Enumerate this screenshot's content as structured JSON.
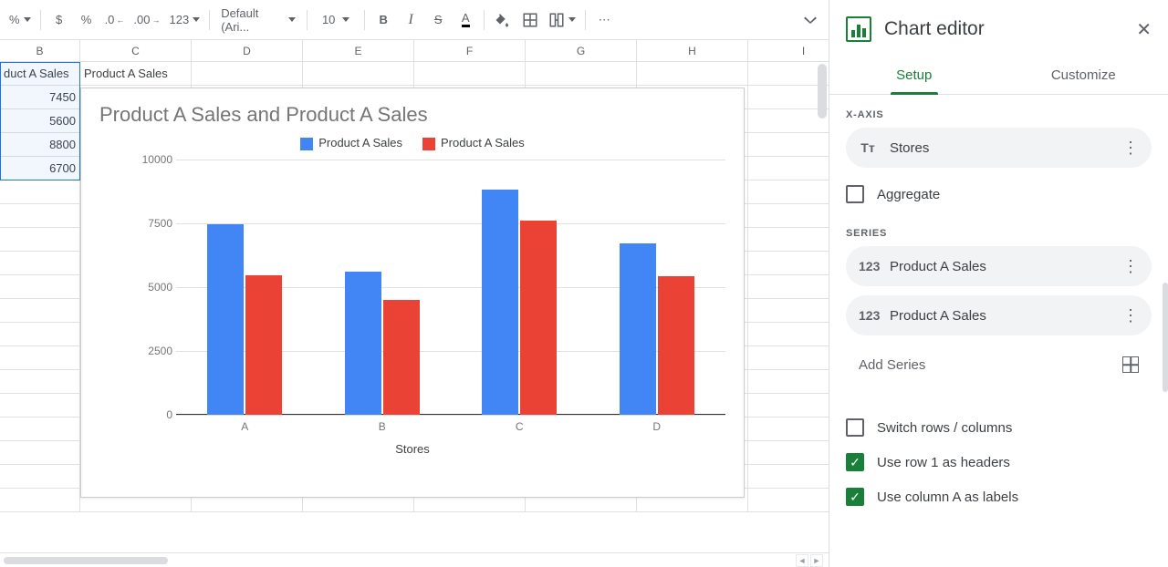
{
  "toolbar": {
    "percent_label": "%",
    "currency_label": "$",
    "percent2_label": "%",
    "dec_dec": ".0",
    "inc_dec": ".00",
    "num_format": "123",
    "font_name": "Default (Ari...",
    "font_size": "10",
    "bold": "B",
    "italic": "I",
    "strike": "S",
    "text_color": "A",
    "more": "⋯"
  },
  "columns": [
    "B",
    "C",
    "D",
    "E",
    "F",
    "G",
    "H",
    "I"
  ],
  "sheet": {
    "b1": "duct A Sales",
    "c1": "Product A Sales",
    "b2": "7450",
    "b3": "5600",
    "b4": "8800",
    "b5": "6700"
  },
  "chart_data": {
    "type": "bar",
    "title": "Product A Sales and Product A Sales",
    "xlabel": "Stores",
    "ylabel": "",
    "categories": [
      "A",
      "B",
      "C",
      "D"
    ],
    "series": [
      {
        "name": "Product A Sales",
        "color": "#4285f4",
        "values": [
          7450,
          5600,
          8800,
          6700
        ]
      },
      {
        "name": "Product A Sales",
        "color": "#ea4335",
        "values": [
          5450,
          4500,
          7600,
          5400
        ]
      }
    ],
    "ylim": [
      0,
      10000
    ],
    "yticks": [
      0,
      2500,
      5000,
      7500,
      10000
    ]
  },
  "panel": {
    "title": "Chart editor",
    "tabs": {
      "setup": "Setup",
      "customize": "Customize"
    },
    "xaxis_label": "X-AXIS",
    "xaxis_value": "Stores",
    "aggregate": "Aggregate",
    "series_label": "SERIES",
    "series": [
      "Product A Sales",
      "Product A Sales"
    ],
    "add_series": "Add Series",
    "switch_rows": "Switch rows / columns",
    "use_row1": "Use row 1 as headers",
    "use_colA": "Use column A as labels",
    "num_prefix": "123"
  }
}
